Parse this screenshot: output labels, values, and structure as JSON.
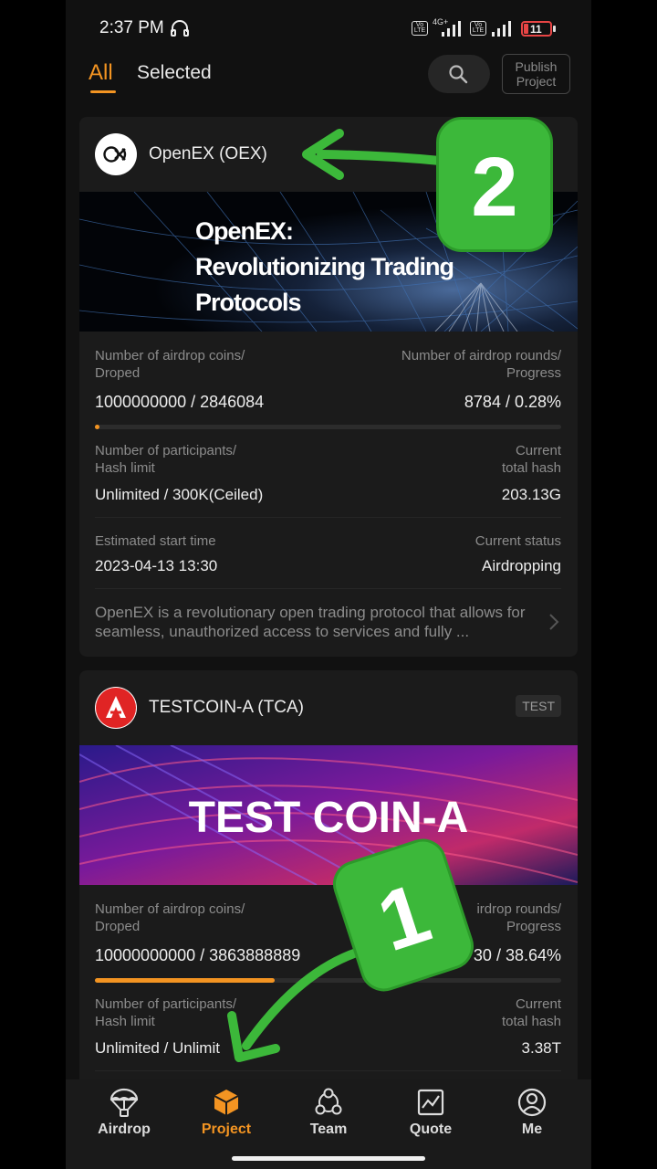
{
  "status_bar": {
    "time": "2:37 PM",
    "network": "4G+",
    "volte": "Vo LTE",
    "battery": "11"
  },
  "header": {
    "tab_all": "All",
    "tab_selected": "Selected",
    "publish": "Publish Project",
    "search_icon": "search-icon"
  },
  "cards": [
    {
      "name": "OpenEX (OEX)",
      "badge": "",
      "banner_text": [
        "OpenEX:",
        "Revolutionizing Trading",
        "Protocols"
      ],
      "coins_label": [
        "Number of airdrop coins/",
        "Droped"
      ],
      "coins_value": "1000000000 / 2846084",
      "rounds_label": [
        "Number of airdrop rounds/",
        "Progress"
      ],
      "rounds_value": "8784 / 0.28%",
      "progress": 0.0028,
      "participants_label": [
        "Number of participants/",
        "Hash limit"
      ],
      "participants_value": "Unlimited / 300K(Ceiled)",
      "hash_label": [
        "Current",
        "total hash"
      ],
      "hash_value": "203.13G",
      "start_label": "Estimated start time",
      "start_value": "2023-04-13 13:30",
      "status_label": "Current status",
      "status_value": "Airdropping",
      "description": "OpenEX is a revolutionary open trading protocol that allows for seamless, unauthorized access to services and fully ..."
    },
    {
      "name": "TESTCOIN-A (TCA)",
      "badge": "TEST",
      "banner_text": [
        "TEST COIN-A"
      ],
      "coins_label": [
        "Number of airdrop coins/",
        "Droped"
      ],
      "coins_value": "10000000000 / 3863888889",
      "rounds_label": [
        "irdrop rounds/",
        "Progress"
      ],
      "rounds_value": "30 / 38.64%",
      "progress": 0.3864,
      "participants_label": [
        "Number of participants/",
        "Hash limit"
      ],
      "participants_value": "Unlimited / Unlimit",
      "hash_label": [
        "Current",
        "total hash"
      ],
      "hash_value": "3.38T"
    }
  ],
  "nav": [
    {
      "label": "Airdrop",
      "icon": "parachute-icon",
      "active": false
    },
    {
      "label": "Project",
      "icon": "cube-icon",
      "active": true
    },
    {
      "label": "Team",
      "icon": "team-icon",
      "active": false
    },
    {
      "label": "Quote",
      "icon": "chart-icon",
      "active": false
    },
    {
      "label": "Me",
      "icon": "profile-icon",
      "active": false
    }
  ],
  "annotations": {
    "step1": "1",
    "step2": "2"
  },
  "colors": {
    "accent": "#f39422",
    "background": "#111111",
    "card": "#1b1b1b",
    "annotation_green": "#3cb83a"
  }
}
